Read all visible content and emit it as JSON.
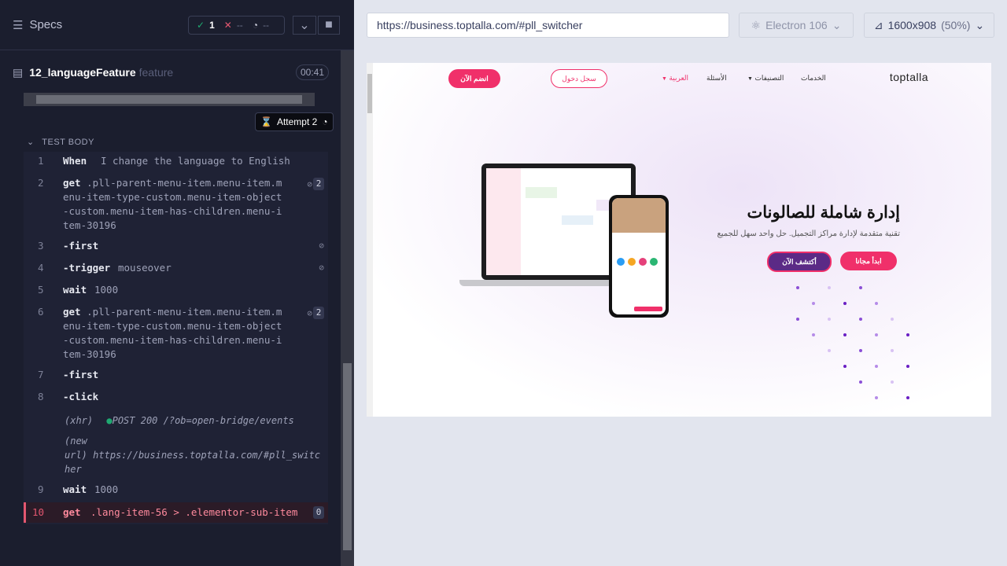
{
  "reporter": {
    "title": "Specs",
    "passed": "1",
    "failed": "--",
    "pending": "--",
    "spec_file": "12_languageFeature",
    "spec_ext": "feature",
    "duration": "00:41",
    "attempt_label": "Attempt 2",
    "section": "TEST BODY",
    "commands": [
      {
        "num": "1",
        "keyword": "When",
        "arg": "I change the language to English"
      },
      {
        "num": "2",
        "keyword": "get",
        "arg": ".pll-parent-menu-item.menu-item.menu-item-type-custom.menu-item-object-custom.menu-item-has-children.menu-item-30196",
        "badge": "2"
      },
      {
        "num": "3",
        "keyword": "-first",
        "arg": ""
      },
      {
        "num": "4",
        "keyword": "-trigger",
        "arg": "mouseover"
      },
      {
        "num": "5",
        "keyword": "wait",
        "arg": "1000"
      },
      {
        "num": "6",
        "keyword": "get",
        "arg": ".pll-parent-menu-item.menu-item.menu-item-type-custom.menu-item-object-custom.menu-item-has-children.menu-item-30196",
        "badge": "2"
      },
      {
        "num": "7",
        "keyword": "-first",
        "arg": ""
      },
      {
        "num": "8",
        "keyword": "-click",
        "arg": ""
      },
      {
        "num": "9",
        "keyword": "wait",
        "arg": "1000"
      },
      {
        "num": "10",
        "keyword": "get",
        "arg": ".lang-item-56 > .elementor-sub-item",
        "badge": "0"
      }
    ],
    "xhr_label": "(xhr)",
    "xhr_text": "POST 200 /?ob=open-bridge/events",
    "newurl_label_1": "(new",
    "newurl_label_2": "url)",
    "newurl_text_1": "https://business.toptalla.com/#pll_switc",
    "newurl_text_2": "her"
  },
  "aut": {
    "url": "https://business.toptalla.com/#pll_switcher",
    "browser": "Electron 106",
    "viewport": "1600x908",
    "scale": "(50%)"
  },
  "site": {
    "logo": "toptalla",
    "nav": [
      "الخدمات",
      "التصنيفات",
      "الأسئلة",
      "العربية"
    ],
    "login": "سجل دخول",
    "join": "انضم الآن",
    "headline": "إدارة شاملة للصالونات",
    "subline": "تقنية متقدمة لإدارة مراكز التجميل. حل واحد سهل للجميع",
    "cta_primary": "ابدأ مجانا",
    "cta_secondary": "أكتشف الآن"
  }
}
